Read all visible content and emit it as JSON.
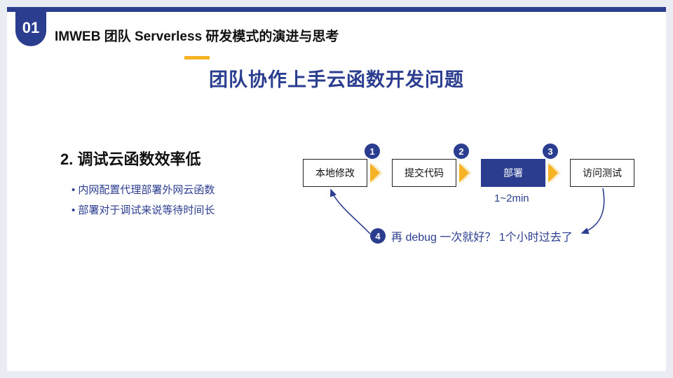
{
  "header": {
    "section_number": "01",
    "breadcrumb": "IMWEB 团队 Serverless 研发模式的演进与思考"
  },
  "title": "团队协作上手云函数开发问题",
  "section": {
    "heading": "2. 调试云函数效率低",
    "bullets": [
      "内网配置代理部署外网云函数",
      "部署对于调试来说等待时间长"
    ]
  },
  "diagram": {
    "steps": [
      {
        "label": "本地修改",
        "badge": "1",
        "highlight": false
      },
      {
        "label": "提交代码",
        "badge": "2",
        "highlight": false
      },
      {
        "label": "部署",
        "badge": "3",
        "highlight": true
      },
      {
        "label": "访问测试",
        "badge": "",
        "highlight": false
      }
    ],
    "deploy_time": "1~2min",
    "feedback": {
      "badge": "4",
      "text": "再 debug 一次就好？ 1个小时过去了"
    }
  }
}
